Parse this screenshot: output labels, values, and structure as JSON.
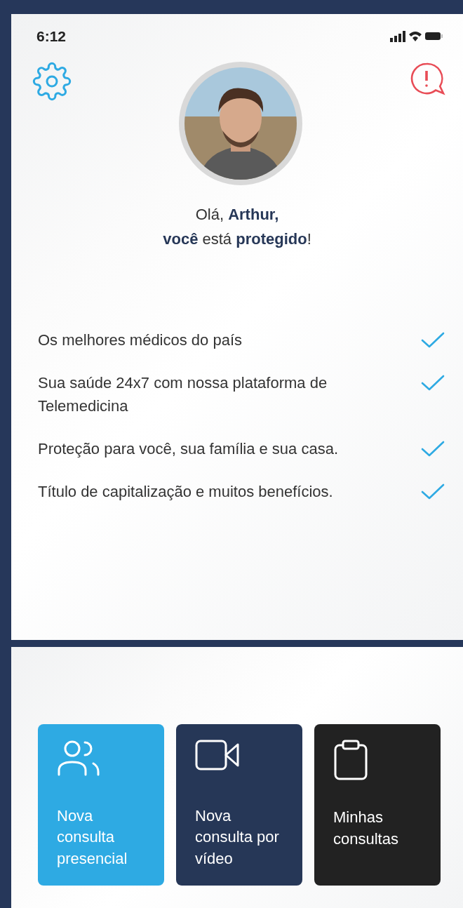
{
  "status_bar": {
    "time": "6:12"
  },
  "greeting_lines": [
    "Olá, **Arthur,**",
    "**você** está **protegido**!"
  ],
  "benefits": [
    {
      "text": "Os melhores médicos do país",
      "checked": true
    },
    {
      "text": "Sua saúde 24x7 com nossa plataforma de Telemedicina",
      "checked": true
    },
    {
      "text": "Proteção para você, sua família e sua casa.",
      "checked": true
    },
    {
      "text": "Título de capitalização e muitos benefícios.",
      "checked": true
    }
  ],
  "actions": [
    {
      "kind": "people",
      "label": "Nova consulta presencial",
      "color": "#2eaae3"
    },
    {
      "kind": "video",
      "label": "Nova consulta por vídeo",
      "color": "#263757"
    },
    {
      "kind": "clipboard",
      "label": "Minhas consultas",
      "color": "#222222"
    }
  ]
}
